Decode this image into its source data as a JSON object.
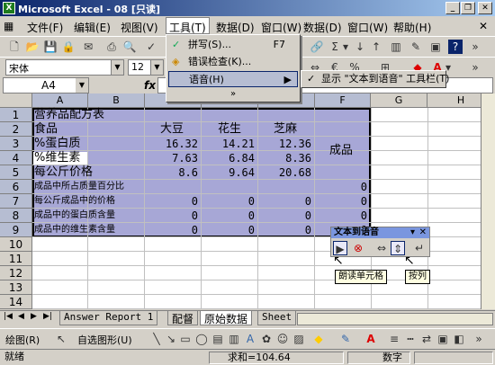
{
  "window": {
    "title": "Microsoft Excel - 08  [只读]",
    "app_icon": "X"
  },
  "menu": [
    {
      "label": "文件(F)"
    },
    {
      "label": "编辑(E)"
    },
    {
      "label": "视图(V)"
    },
    {
      "label": "工具(T)"
    },
    {
      "label": "数据(D)"
    },
    {
      "label": "窗口(W)"
    },
    {
      "label": "数据(D)"
    },
    {
      "label": "窗口(W)"
    },
    {
      "label": "帮助(H)"
    }
  ],
  "format_bar": {
    "font": "宋体",
    "size": "12"
  },
  "namebox": "A4",
  "fx_label": "fx",
  "tools_menu": {
    "items": [
      {
        "label": "拼写(S)...",
        "shortcut": "F7"
      },
      {
        "label": "错误检查(K)..."
      },
      {
        "label": "语音(H)"
      }
    ],
    "expand": "»"
  },
  "speech_submenu": {
    "label": "显示 \"文本到语音\" 工具栏(T)"
  },
  "columns": [
    "A",
    "B",
    "C",
    "D",
    "E",
    "F",
    "G",
    "H"
  ],
  "rows": [
    "1",
    "2",
    "3",
    "4",
    "5",
    "6",
    "7",
    "8",
    "9",
    "10",
    "11",
    "12",
    "13",
    "14"
  ],
  "sheet": {
    "r1": {
      "A": "营养品配方表"
    },
    "r2": {
      "A": "食品",
      "C": "大豆",
      "D": "花生",
      "E": "芝麻"
    },
    "r3": {
      "A": "%蛋白质",
      "C": "16.32",
      "D": "14.21",
      "E": "12.36"
    },
    "r4": {
      "A": "%维生素",
      "C": "7.63",
      "D": "6.84",
      "E": "8.36"
    },
    "r5": {
      "A": "每公斤价格",
      "C": "8.6",
      "D": "9.64",
      "E": "20.68"
    },
    "r6": {
      "A": "成品中所占质量百分比",
      "F": "0"
    },
    "r7": {
      "A": "每公斤成品中的价格",
      "C": "0",
      "D": "0",
      "E": "0",
      "F": "0"
    },
    "r8": {
      "A": "成品中的蛋白质含量",
      "C": "0",
      "D": "0",
      "E": "0",
      "F": "0"
    },
    "r9": {
      "A": "成品中的维生素含量",
      "C": "0",
      "D": "0",
      "E": "0",
      "F": "0"
    },
    "f_merged": "成品"
  },
  "tts_toolbar": {
    "title": "文本到语音",
    "tip_read": "朗读单元格",
    "tip_byrow": "按列"
  },
  "tabs": [
    {
      "label": "Answer Report 1"
    },
    {
      "label": "配督"
    },
    {
      "label": "原始数据"
    },
    {
      "label": "Sheet"
    }
  ],
  "drawbar": {
    "draw": "绘图(R)",
    "autoshapes": "自选图形(U)"
  },
  "status": {
    "ready": "就绪",
    "sum": "求和=104.64",
    "mode": "数字"
  },
  "colors": {
    "selection": "#a7a7d6",
    "title_start": "#0a246a"
  }
}
